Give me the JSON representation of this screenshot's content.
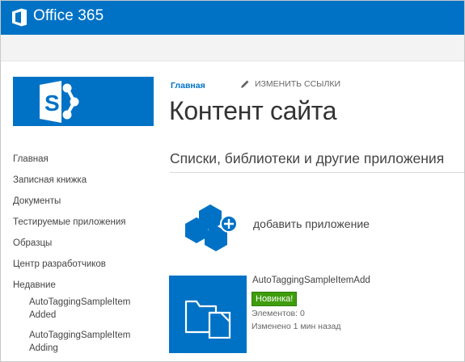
{
  "suite": {
    "title": "Office 365",
    "logo_icon": "office-logo-icon",
    "accent": "#0072c6"
  },
  "site": {
    "logo_icon": "sharepoint-logo-icon"
  },
  "breadcrumb": {
    "home": "Главная",
    "edit_links": "ИЗМЕНИТЬ ССЫЛКИ",
    "edit_icon": "pencil-icon"
  },
  "page": {
    "title": "Контент сайта",
    "section": "Списки, библиотеки и другие приложения"
  },
  "nav": {
    "items": [
      {
        "label": "Главная"
      },
      {
        "label": "Записная книжка"
      },
      {
        "label": "Документы"
      },
      {
        "label": "Тестируемые приложения"
      },
      {
        "label": "Образцы"
      },
      {
        "label": "Центр разработчиков"
      },
      {
        "label": "Недавние"
      }
    ],
    "recent": [
      {
        "label": "AutoTaggingSampleItem Added"
      },
      {
        "label": "AutoTaggingSampleItem Adding"
      }
    ]
  },
  "add_app": {
    "label": "добавить приложение",
    "icon": "add-app-icon"
  },
  "app": {
    "name": "AutoTaggingSampleItemAdd",
    "badge": "Новинка!",
    "items": "Элементов: 0",
    "modified": "Изменено 1 мин назад",
    "icon": "folder-library-icon",
    "badge_color": "#3f9d0d"
  }
}
